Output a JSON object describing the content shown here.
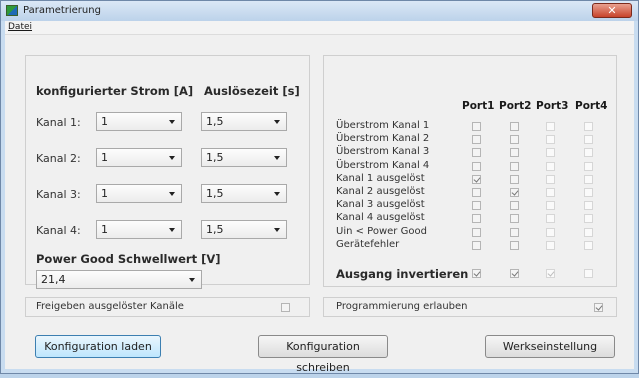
{
  "window": {
    "title": "Parametrierung",
    "close_glyph": "✕"
  },
  "menu": {
    "datei": "Datei"
  },
  "left": {
    "heading_current": "konfigurierter Strom [A]",
    "heading_time": "Auslösezeit [s]",
    "channels": [
      {
        "label": "Kanal 1:",
        "current": "1",
        "time": "1,5"
      },
      {
        "label": "Kanal 2:",
        "current": "1",
        "time": "1,5"
      },
      {
        "label": "Kanal 3:",
        "current": "1",
        "time": "1,5"
      },
      {
        "label": "Kanal 4:",
        "current": "1",
        "time": "1,5"
      }
    ],
    "power_good_heading": "Power Good Schwellwert [V]",
    "power_good_value": "21,4"
  },
  "right": {
    "ports": [
      "Port1",
      "Port2",
      "Port3",
      "Port4"
    ],
    "rows": [
      {
        "label": "Überstrom Kanal 1",
        "checks": [
          false,
          false,
          false,
          false
        ]
      },
      {
        "label": "Überstrom Kanal 2",
        "checks": [
          false,
          false,
          false,
          false
        ]
      },
      {
        "label": "Überstrom Kanal 3",
        "checks": [
          false,
          false,
          false,
          false
        ]
      },
      {
        "label": "Überstrom Kanal 4",
        "checks": [
          false,
          false,
          false,
          false
        ]
      },
      {
        "label": "Kanal 1 ausgelöst",
        "checks": [
          true,
          false,
          false,
          false
        ]
      },
      {
        "label": "Kanal 2 ausgelöst",
        "checks": [
          false,
          true,
          false,
          false
        ]
      },
      {
        "label": "Kanal 3 ausgelöst",
        "checks": [
          false,
          false,
          false,
          false
        ]
      },
      {
        "label": "Kanal 4 ausgelöst",
        "checks": [
          false,
          false,
          false,
          false
        ]
      },
      {
        "label": "Uin < Power Good",
        "checks": [
          false,
          false,
          false,
          false
        ]
      },
      {
        "label": "Gerätefehler",
        "checks": [
          false,
          false,
          false,
          false
        ]
      }
    ],
    "invert_label": "Ausgang invertieren",
    "invert_checks": [
      true,
      true,
      true,
      false
    ]
  },
  "bottom": {
    "release_label": "Freigeben ausgelöster Kanäle",
    "release_checked": false,
    "program_label": "Programmierung erlauben",
    "program_checked": true
  },
  "buttons": {
    "load": "Konfiguration laden",
    "write": "Konfiguration schreiben",
    "factory": "Werkseinstellung"
  }
}
